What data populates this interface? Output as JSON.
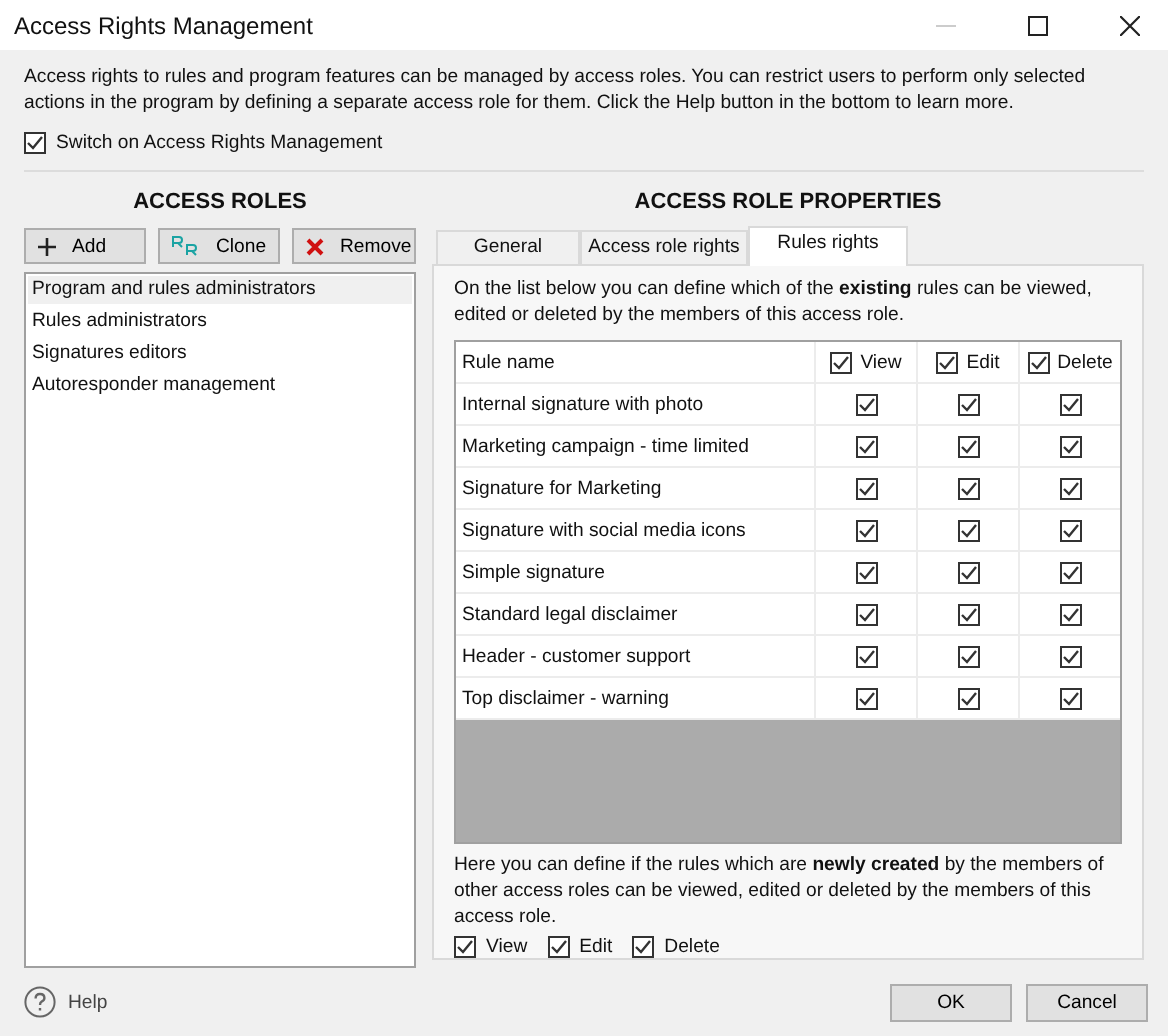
{
  "window": {
    "title": "Access Rights Management"
  },
  "intro": "Access rights to rules and program features can be managed by access roles. You can restrict users to perform only selected actions in the program by defining a separate access role for them. Click the Help button in the bottom to learn more.",
  "master_switch": {
    "label": "Switch on Access Rights Management",
    "checked": true
  },
  "roles_panel": {
    "title": "ACCESS ROLES",
    "buttons": [
      {
        "kind": "add",
        "label": "Add"
      },
      {
        "kind": "clone",
        "label": "Clone"
      },
      {
        "kind": "remove",
        "label": "Remove"
      }
    ],
    "items": [
      {
        "label": "Program and rules administrators",
        "selected": true
      },
      {
        "label": "Rules administrators",
        "selected": false
      },
      {
        "label": "Signatures editors",
        "selected": false
      },
      {
        "label": "Autoresponder management",
        "selected": false
      }
    ]
  },
  "properties_panel": {
    "title": "ACCESS ROLE PROPERTIES",
    "tabs": [
      {
        "label": "General",
        "selected": false
      },
      {
        "label": "Access role rights",
        "selected": false
      },
      {
        "label": "Rules rights",
        "selected": true
      }
    ],
    "description": "On the list below you can define which of the **existing** rules can be viewed, edited or deleted by the members of this access role.",
    "table": {
      "columns": [
        {
          "kind": "text",
          "label": "Rule name"
        },
        {
          "kind": "checkbox",
          "label": "View",
          "checked": true
        },
        {
          "kind": "checkbox",
          "label": "Edit",
          "checked": true
        },
        {
          "kind": "checkbox",
          "label": "Delete",
          "checked": true
        }
      ],
      "rows": [
        {
          "name": "Internal signature with photo",
          "view": true,
          "edit": true,
          "delete": true
        },
        {
          "name": "Marketing campaign - time limited",
          "view": true,
          "edit": true,
          "delete": true
        },
        {
          "name": "Signature for Marketing",
          "view": true,
          "edit": true,
          "delete": true
        },
        {
          "name": "Signature with social media icons",
          "view": true,
          "edit": true,
          "delete": true
        },
        {
          "name": "Simple signature",
          "view": true,
          "edit": true,
          "delete": true
        },
        {
          "name": "Standard legal disclaimer",
          "view": true,
          "edit": true,
          "delete": true
        },
        {
          "name": "Header - customer support",
          "view": true,
          "edit": true,
          "delete": true
        },
        {
          "name": "Top disclaimer - warning",
          "view": true,
          "edit": true,
          "delete": true
        }
      ]
    },
    "new_rules_note": "Here you can define if the rules which are **newly created** by the members of other access roles can be viewed, edited or deleted by the members of this access role.",
    "new_rules_options": [
      {
        "label": "View",
        "checked": true
      },
      {
        "label": "Edit",
        "checked": true
      },
      {
        "label": "Delete",
        "checked": true
      }
    ]
  },
  "help": {
    "label": "Help"
  },
  "dialog_buttons": [
    "OK",
    "Cancel"
  ]
}
